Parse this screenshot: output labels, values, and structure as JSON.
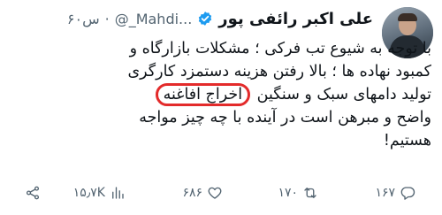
{
  "author": {
    "name": "علی اکبر رائفی پور",
    "handle": "@_Mahdi...",
    "time": "۶۰س"
  },
  "tweet": {
    "lines": [
      "با توجه به شیوع تب فرکی ؛ مشکلات بازارگاه و",
      "کمبود نهاده ها ؛ بالا رفتن هزینه دستمزد کارگری",
      "تولید دامهای سبک و سنگین",
      "اخراج افاغنه",
      "واضح و مبرهن است در آینده با چه چیز مواجه",
      "هستیم!"
    ]
  },
  "actions": {
    "replies": "۱۶۷",
    "retweets": "۱۷۰",
    "likes": "۶۸۶",
    "views": "۱۵٫۷K"
  },
  "colors": {
    "verified": "#1d9bf0",
    "highlight_circle": "#e32b2b",
    "secondary_text": "#536471"
  }
}
